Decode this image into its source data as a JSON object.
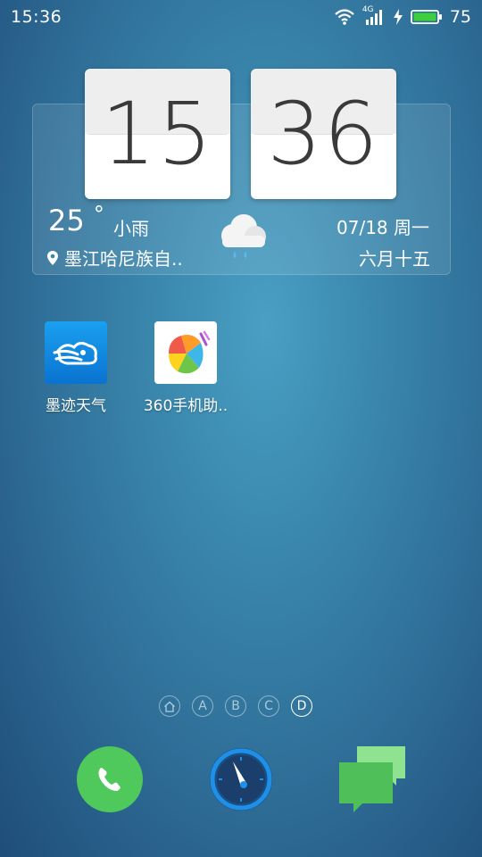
{
  "status_bar": {
    "time": "15:36",
    "network": "4G",
    "battery": "75",
    "icons": [
      "wifi-icon",
      "signal-icon",
      "charging-icon",
      "battery-icon"
    ]
  },
  "clock_widget": {
    "hours": "15",
    "minutes": "36"
  },
  "weather": {
    "temperature": "25",
    "degree": "°",
    "condition": "小雨",
    "location": "墨江哈尼族自..",
    "date": "07/18 周一",
    "lunar": "六月十五",
    "icon": "rain-cloud-icon"
  },
  "apps": [
    {
      "label": "墨迹天气",
      "icon": "moji-weather-icon"
    },
    {
      "label": "360手机助..",
      "icon": "app-360-icon"
    }
  ],
  "page_indicator": [
    "A",
    "B",
    "C",
    "D"
  ],
  "active_page": "D",
  "dock": [
    {
      "name": "phone",
      "icon": "phone-icon"
    },
    {
      "name": "browser",
      "icon": "compass-icon"
    },
    {
      "name": "messages",
      "icon": "messages-icon"
    }
  ],
  "colors": {
    "phone_green": "#4fc85c",
    "compass_blue": "#1e90e8",
    "messages_green": "#5fc766",
    "battery_green": "#3ecf3e"
  }
}
